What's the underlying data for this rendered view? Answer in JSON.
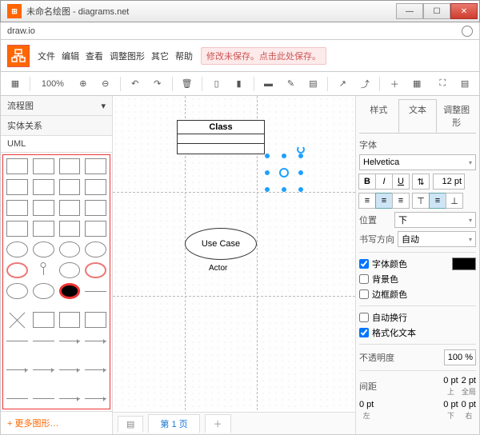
{
  "window": {
    "title": "未命名绘图 - diagrams.net"
  },
  "appbar": {
    "name": "draw.io"
  },
  "menu": {
    "file": "文件",
    "edit": "编辑",
    "view": "查看",
    "arrange": "调整图形",
    "extras": "其它",
    "help": "帮助",
    "unsaved": "修改未保存。点击此处保存。"
  },
  "toolbar": {
    "zoom": "100%"
  },
  "sidebar": {
    "cat_flow": "流程图",
    "cat_er": "实体关系",
    "cat_uml": "UML",
    "more": "+ 更多图形…"
  },
  "canvas": {
    "class_title": "Class",
    "usecase_label": "Use Case",
    "actor_label": "Actor",
    "page1": "第 1 页"
  },
  "format": {
    "tab_style": "样式",
    "tab_text": "文本",
    "tab_arrange": "调整图形",
    "font_label": "字体",
    "font_family": "Helvetica",
    "font_size": "12 pt",
    "pos_label": "位置",
    "pos_value": "下",
    "dir_label": "书写方向",
    "dir_value": "自动",
    "font_color": "字体颜色",
    "bg_color": "背景色",
    "border_color": "边框颜色",
    "auto_wrap": "自动换行",
    "formatted": "格式化文本",
    "opacity_label": "不透明度",
    "opacity_value": "100 %",
    "spacing_label": "间距",
    "sp_top": "0 pt",
    "sp_global": "2 pt",
    "sp_left": "0 pt",
    "sp_bottom": "0 pt",
    "sp_right": "0 pt",
    "lbl_top": "上",
    "lbl_global": "全局",
    "lbl_left": "左",
    "lbl_bottom": "下",
    "lbl_right": "右"
  }
}
